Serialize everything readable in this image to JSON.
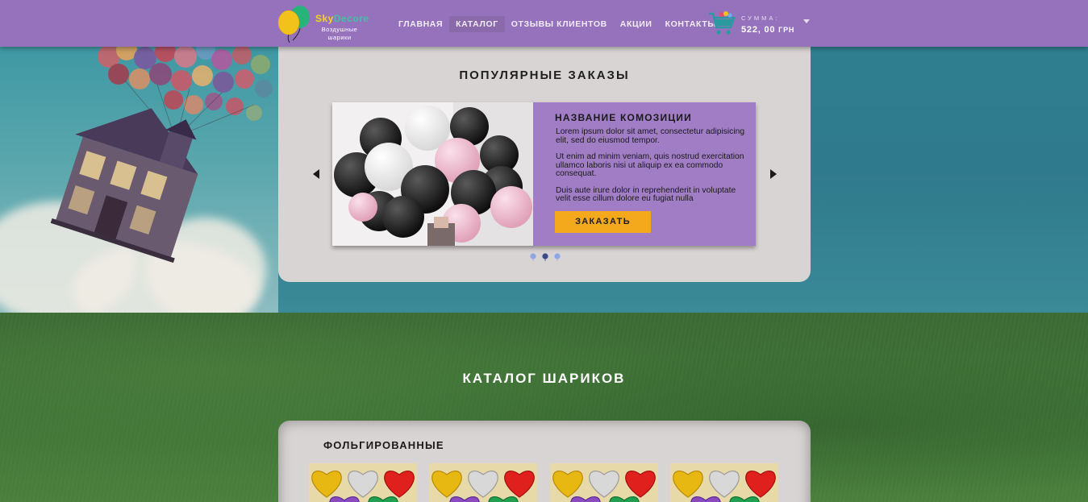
{
  "header": {
    "logo": {
      "title_part1": "Sky",
      "title_part2": "Decore",
      "subtitle": "Воздушные шарики"
    },
    "nav": [
      {
        "label": "ГЛАВНАЯ"
      },
      {
        "label": "КАТАЛОГ",
        "active": true
      },
      {
        "label": "ОТЗЫВЫ КЛИЕНТОВ"
      },
      {
        "label": "АКЦИИ"
      },
      {
        "label": "КОНТАКТЫ"
      }
    ],
    "cart": {
      "label": "СУММА:",
      "amount": "522, 00",
      "currency": "ГРН"
    }
  },
  "popular": {
    "title": "ПОПУЛЯРНЫЕ ЗАКАЗЫ",
    "slide": {
      "title": "НАЗВАНИЕ КОМОЗИЦИИ",
      "paragraphs": [
        "Lorem ipsum dolor sit amet, consectetur adipisicing elit, sed do eiusmod tempor.",
        "Ut enim ad minim veniam, quis nostrud exercitation ullamco laboris nisi ut aliquip ex ea commodo consequat.",
        "Duis aute irure dolor in reprehenderit in voluptate velit esse cillum dolore eu fugiat nulla"
      ],
      "button_label": "ЗАКАЗАТЬ"
    },
    "carousel": {
      "slides_count": 3,
      "active_index": 1
    }
  },
  "catalog": {
    "title": "КАТАЛОГ ШАРИКОВ",
    "category_title": "ФОЛЬГИРОВАННЫЕ",
    "items_visible": 4
  },
  "colors": {
    "header_bg": "#9672bd",
    "panel_bg": "#d9d4d4",
    "slide_info_bg": "#a07dc4",
    "button_bg": "#f4a81c",
    "dot_color": "#8ea6e6",
    "dot_active": "#3a4a8a"
  },
  "icons": [
    "balloons-logo-icon",
    "cart-icon",
    "caret-down-icon",
    "arrow-left-icon",
    "arrow-right-icon",
    "carousel-dot-icon"
  ]
}
